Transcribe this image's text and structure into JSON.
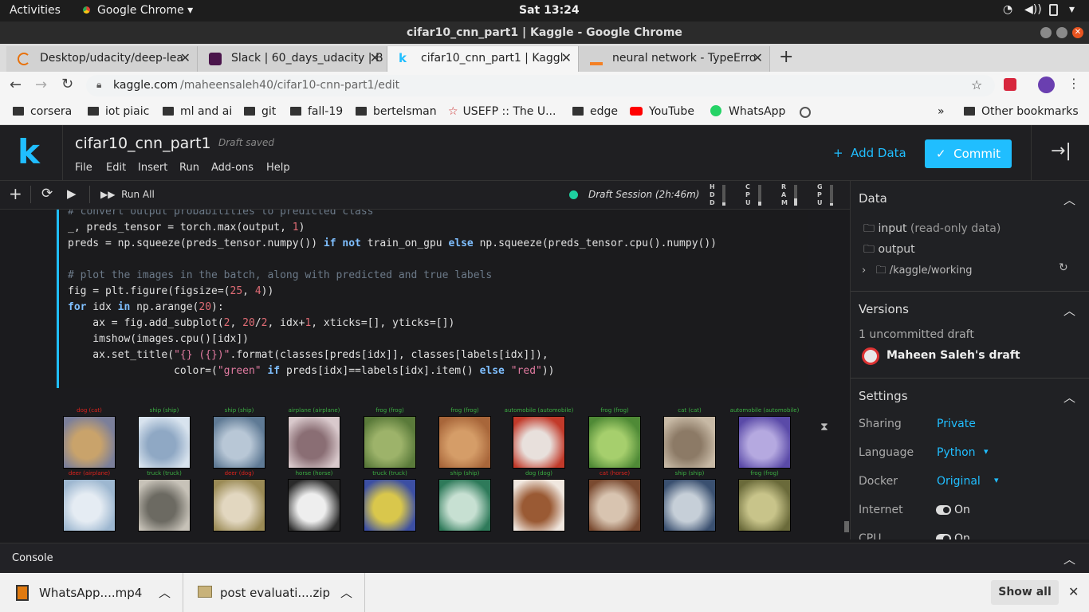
{
  "os": {
    "activities": "Activities",
    "app_name": "Google Chrome",
    "clock": "Sat 13:24"
  },
  "window": {
    "title": "cifar10_cnn_part1 | Kaggle - Google Chrome"
  },
  "tabs": [
    {
      "label": "Desktop/udacity/deep-lea",
      "icon": "loading-icon"
    },
    {
      "label": "Slack | 60_days_udacity | B",
      "icon": "slack-icon"
    },
    {
      "label": "cifar10_cnn_part1 | Kaggl",
      "icon": "kaggle-icon"
    },
    {
      "label": "neural network - TypeErro",
      "icon": "stackoverflow-icon"
    }
  ],
  "address": {
    "host": "kaggle.com",
    "path": "/maheensaleh40/cifar10-cnn-part1/edit"
  },
  "bookmarks": [
    {
      "label": "corsera",
      "type": "folder"
    },
    {
      "label": "iot piaic",
      "type": "folder"
    },
    {
      "label": "ml and ai",
      "type": "folder"
    },
    {
      "label": "git",
      "type": "folder"
    },
    {
      "label": "fall-19",
      "type": "folder"
    },
    {
      "label": "bertelsman",
      "type": "folder"
    },
    {
      "label": "USEFP :: The U...",
      "type": "site"
    },
    {
      "label": "edge",
      "type": "folder"
    },
    {
      "label": "YouTube",
      "type": "site"
    },
    {
      "label": "WhatsApp",
      "type": "site"
    }
  ],
  "bookmarks_more": "»",
  "other_bookmarks": "Other bookmarks",
  "kaggle": {
    "logo": "k",
    "notebook_title": "cifar10_cnn_part1",
    "save_status": "Draft saved",
    "menu": [
      "File",
      "Edit",
      "Insert",
      "Run",
      "Add-ons",
      "Help"
    ],
    "add_data": "Add Data",
    "commit": "Commit",
    "run_all": "Run All",
    "session": "Draft Session (2h:46m)",
    "meters": [
      {
        "letters": [
          "H",
          "D",
          "D"
        ],
        "level": 0.15
      },
      {
        "letters": [
          "C",
          "P",
          "U"
        ],
        "level": 0.2
      },
      {
        "letters": [
          "R",
          "A",
          "M"
        ],
        "level": 0.35
      },
      {
        "letters": [
          "G",
          "P",
          "U"
        ],
        "level": 0.1
      }
    ]
  },
  "code": [
    [
      [
        "cm",
        "# convert output probabilities to predicted class"
      ]
    ],
    [
      [
        "",
        "_, preds_tensor = torch.max(output, "
      ],
      [
        "num",
        "1"
      ],
      [
        "",
        ")"
      ]
    ],
    [
      [
        "",
        "preds = np.squeeze(preds_tensor.numpy()) "
      ],
      [
        "kw",
        "if not"
      ],
      [
        "pl",
        " train_on_gpu "
      ],
      [
        "kw",
        "else"
      ],
      [
        "pl",
        " np.squeeze(preds_tensor.cpu().numpy())"
      ]
    ],
    [
      [
        "",
        ""
      ]
    ],
    [
      [
        "cm",
        "# plot the images in the batch, along with predicted and true labels"
      ]
    ],
    [
      [
        "",
        "fig = plt.figure(figsize=("
      ],
      [
        "num",
        "25"
      ],
      [
        "",
        ", "
      ],
      [
        "num",
        "4"
      ],
      [
        "",
        "))"
      ]
    ],
    [
      [
        "kw",
        "for"
      ],
      [
        "",
        " idx "
      ],
      [
        "kw",
        "in"
      ],
      [
        "",
        " np.arange("
      ],
      [
        "num",
        "20"
      ],
      [
        "",
        "):"
      ]
    ],
    [
      [
        "",
        "    ax = fig.add_subplot("
      ],
      [
        "num",
        "2"
      ],
      [
        "",
        ", "
      ],
      [
        "num",
        "20"
      ],
      [
        "",
        "/"
      ],
      [
        "num",
        "2"
      ],
      [
        "",
        ", idx+"
      ],
      [
        "num",
        "1"
      ],
      [
        "",
        ", xticks=[], yticks=[])"
      ]
    ],
    [
      [
        "",
        "    imshow(images.cpu()[idx])"
      ]
    ],
    [
      [
        "",
        "    ax.set_title("
      ],
      [
        "str",
        "\"{} ({})\""
      ],
      [
        "",
        ".format(classes[preds[idx]], classes[labels[idx]]),"
      ]
    ],
    [
      [
        "",
        "                 color=("
      ],
      [
        "str",
        "\"green\""
      ],
      [
        "kw",
        " if"
      ],
      [
        "",
        " preds[idx]==labels[idx].item() "
      ],
      [
        "kw",
        "else"
      ],
      [
        "str",
        " \"red\""
      ],
      [
        "",
        "))"
      ]
    ]
  ],
  "predictions": [
    {
      "title": "dog (cat)",
      "correct": false,
      "c1": "#7b7f9a",
      "c2": "#c9a36b"
    },
    {
      "title": "ship (ship)",
      "correct": true,
      "c1": "#d8e3ee",
      "c2": "#8fa8c4"
    },
    {
      "title": "ship (ship)",
      "correct": true,
      "c1": "#5f7a95",
      "c2": "#b8c7d6"
    },
    {
      "title": "airplane (airplane)",
      "correct": true,
      "c1": "#d9c9cc",
      "c2": "#8a6e74"
    },
    {
      "title": "frog (frog)",
      "correct": true,
      "c1": "#5a7a3a",
      "c2": "#9db36a"
    },
    {
      "title": "frog (frog)",
      "correct": true,
      "c1": "#a8663a",
      "c2": "#d59d68"
    },
    {
      "title": "automobile (automobile)",
      "correct": true,
      "c1": "#c23a2a",
      "c2": "#e8e0dc"
    },
    {
      "title": "frog (frog)",
      "correct": true,
      "c1": "#4f8a36",
      "c2": "#a6cf6d"
    },
    {
      "title": "cat (cat)",
      "correct": true,
      "c1": "#c7b9a5",
      "c2": "#8c7a66"
    },
    {
      "title": "automobile (automobile)",
      "correct": true,
      "c1": "#5a4aa8",
      "c2": "#b5a9e0"
    },
    {
      "title": "deer (airplane)",
      "correct": false,
      "c1": "#9db7d0",
      "c2": "#e5ecf3"
    },
    {
      "title": "truck (truck)",
      "correct": true,
      "c1": "#c7c2b8",
      "c2": "#6c6a62"
    },
    {
      "title": "deer (dog)",
      "correct": false,
      "c1": "#9a8a55",
      "c2": "#e2d7c0"
    },
    {
      "title": "horse (horse)",
      "correct": true,
      "c1": "#2a2a2a",
      "c2": "#eeeeee"
    },
    {
      "title": "truck (truck)",
      "correct": true,
      "c1": "#3c4fa3",
      "c2": "#d9c74c"
    },
    {
      "title": "ship (ship)",
      "correct": true,
      "c1": "#2e7a5a",
      "c2": "#c7e0d2"
    },
    {
      "title": "dog (dog)",
      "correct": true,
      "c1": "#f0e7df",
      "c2": "#9a5a34"
    },
    {
      "title": "cat (horse)",
      "correct": false,
      "c1": "#7a4a30",
      "c2": "#d8c4b0"
    },
    {
      "title": "ship (ship)",
      "correct": true,
      "c1": "#3a5070",
      "c2": "#c6cfd8"
    },
    {
      "title": "frog (frog)",
      "correct": true,
      "c1": "#6a6a3a",
      "c2": "#c8c48a"
    }
  ],
  "sidebar": {
    "data": {
      "title": "Data",
      "items": [
        {
          "label": "input",
          "suffix": "(read-only data)"
        },
        {
          "label": "output",
          "suffix": ""
        },
        {
          "label": "/kaggle/working",
          "suffix": ""
        }
      ]
    },
    "versions": {
      "title": "Versions",
      "count": "1 uncommitted draft",
      "draft": "Maheen Saleh's draft"
    },
    "settings": {
      "title": "Settings",
      "rows": [
        {
          "key": "Sharing",
          "value": "Private",
          "dropdown": false
        },
        {
          "key": "Language",
          "value": "Python",
          "dropdown": true
        },
        {
          "key": "Docker",
          "value": "Original",
          "dropdown": true
        },
        {
          "key": "Internet",
          "value": "On",
          "toggle": true
        },
        {
          "key": "CPU",
          "value": "On",
          "toggle": true
        }
      ]
    }
  },
  "console": "Console",
  "downloads": [
    {
      "name": "WhatsApp....mp4"
    },
    {
      "name": "post evaluati....zip"
    }
  ],
  "show_all": "Show all",
  "colors": {
    "accent": "#20beff",
    "correct": "#3cb043",
    "wrong": "#e0231c"
  }
}
